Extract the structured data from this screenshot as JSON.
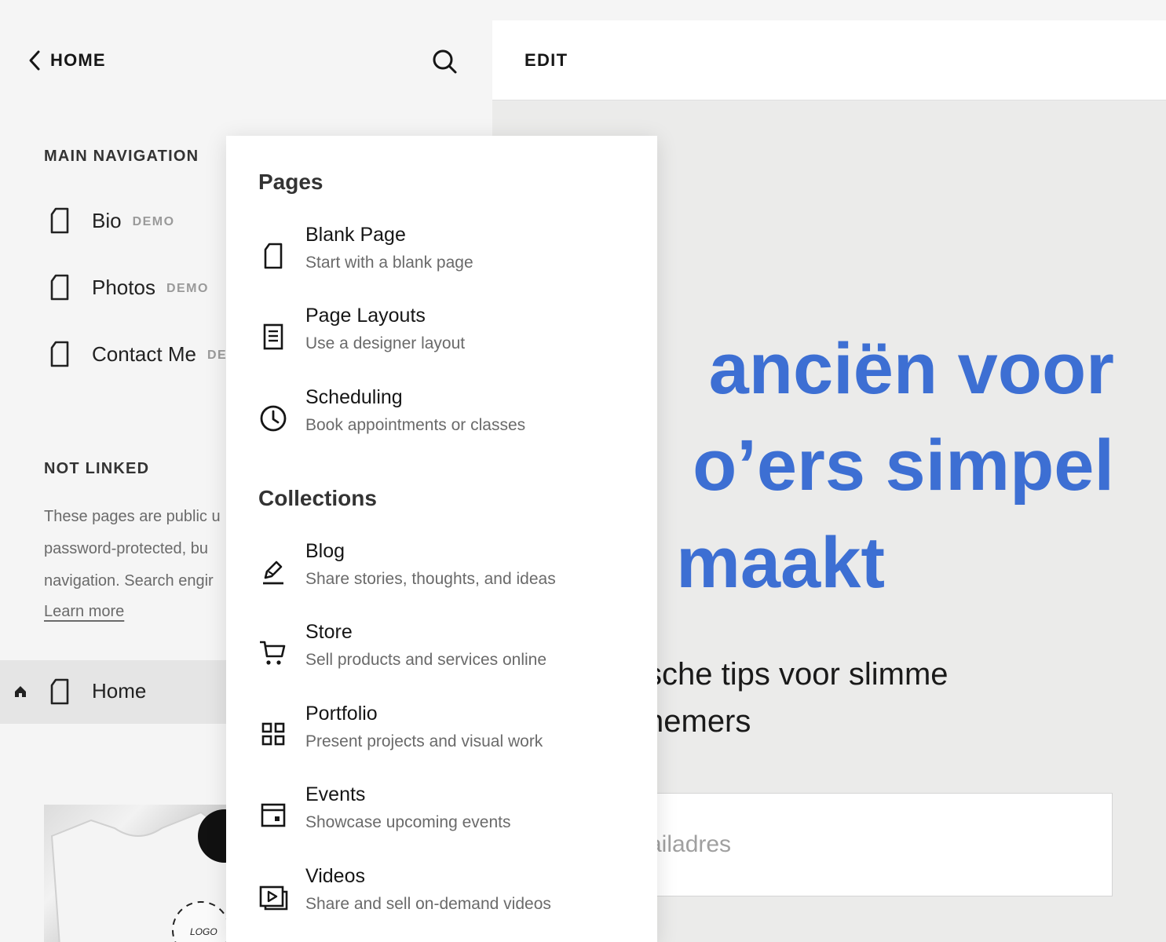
{
  "sidebar": {
    "back_label": "HOME",
    "main_nav_title": "MAIN NAVIGATION",
    "main_nav_items": [
      {
        "label": "Bio",
        "badge": "DEMO"
      },
      {
        "label": "Photos",
        "badge": "DEMO"
      },
      {
        "label": "Contact Me",
        "badge": "DEMO"
      }
    ],
    "not_linked_title": "NOT LINKED",
    "not_linked_desc": [
      "These pages are public u",
      "password-protected, bu",
      "navigation. Search engir"
    ],
    "learn_more": "Learn more",
    "home_item": {
      "label": "Home"
    },
    "thumb_logo": "LOGO"
  },
  "preview": {
    "edit_label": "EDIT",
    "headline": [
      "anciën voor",
      "o’ers simpel",
      "maakt"
    ],
    "subheadline": [
      "sche tips voor slimme",
      "nemers"
    ],
    "email_placeholder": "ailadres",
    "accent_color": "#3d6fd3"
  },
  "menu": {
    "pages_title": "Pages",
    "pages": [
      {
        "title": "Blank Page",
        "subtitle": "Start with a blank page",
        "icon": "page-icon"
      },
      {
        "title": "Page Layouts",
        "subtitle": "Use a designer layout",
        "icon": "layout-icon"
      },
      {
        "title": "Scheduling",
        "subtitle": "Book appointments or classes",
        "icon": "clock-icon"
      }
    ],
    "collections_title": "Collections",
    "collections": [
      {
        "title": "Blog",
        "subtitle": "Share stories, thoughts, and ideas",
        "icon": "pen-icon"
      },
      {
        "title": "Store",
        "subtitle": "Sell products and services online",
        "icon": "cart-icon"
      },
      {
        "title": "Portfolio",
        "subtitle": "Present projects and visual work",
        "icon": "grid-icon"
      },
      {
        "title": "Events",
        "subtitle": "Showcase upcoming events",
        "icon": "calendar-icon"
      },
      {
        "title": "Videos",
        "subtitle": "Share and sell on-demand videos",
        "icon": "video-icon"
      }
    ]
  }
}
